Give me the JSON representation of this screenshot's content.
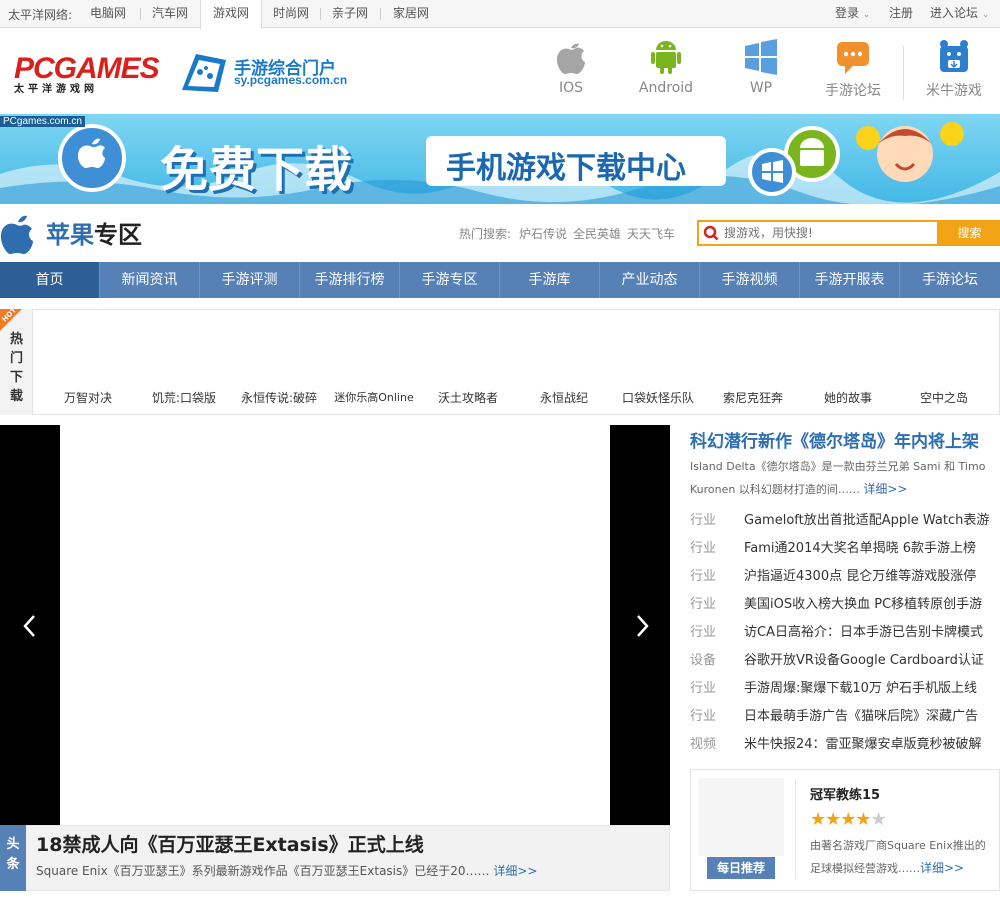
{
  "topbar": {
    "network_label": "太平洋网络:",
    "sites": [
      "电脑网",
      "汽车网",
      "游戏网",
      "时尚网",
      "亲子网",
      "家居网"
    ],
    "login": "登录",
    "register": "注册",
    "forum": "进入论坛"
  },
  "header": {
    "logo_text": "PCGAMES",
    "logo_sub": "太平洋游戏网",
    "portal_title": "手游综合门户",
    "portal_url": "sy.pcgames.com.cn",
    "platforms": [
      "IOS",
      "Android",
      "WP",
      "手游论坛",
      "米牛游戏"
    ]
  },
  "banner": {
    "tag": "PCgames.com.cn",
    "free_download": "免费下载",
    "center_text": "手机游戏下载中心"
  },
  "zone": {
    "title_blue": "苹果",
    "title_dark": "专区",
    "hot_search_label": "热门搜索:",
    "hot_keywords": [
      "炉石传说",
      "全民英雄",
      "天天飞车"
    ],
    "search_placeholder": "搜游戏，用快搜!",
    "search_button": "搜索"
  },
  "nav": [
    "首页",
    "新闻资讯",
    "手游评测",
    "手游排行榜",
    "手游专区",
    "手游库",
    "产业动态",
    "手游视频",
    "手游开服表",
    "手游论坛"
  ],
  "hot_downloads": {
    "badge": "HOT",
    "label_chars": [
      "热",
      "门",
      "下",
      "载"
    ],
    "games": [
      "万智对决",
      "饥荒:口袋版",
      "永恒传说:破碎",
      "迷你乐高Online",
      "沃土攻略者",
      "永恒战纪",
      "口袋妖怪乐队",
      "索尼克狂奔",
      "她的故事",
      "空中之岛"
    ]
  },
  "headline": {
    "tag": "头条",
    "title": "18禁成人向《百万亚瑟王Extasis》正式上线",
    "desc": "Square Enix《百万亚瑟王》系列最新游戏作品《百万亚瑟王Extasis》已经于20……",
    "more": "详细>>"
  },
  "feature": {
    "title": "科幻潜行新作《德尔塔岛》年内将上架",
    "desc": "Island Delta《德尔塔岛》是一款由芬兰兄弟 Sami 和 Timo Kuronen 以科幻题材打造的间……",
    "more": "详细>>"
  },
  "news": [
    {
      "cat": "行业",
      "title": "Gameloft放出首批适配Apple Watch表游"
    },
    {
      "cat": "行业",
      "title": "Fami通2014大奖名单揭晓 6款手游上榜"
    },
    {
      "cat": "行业",
      "title": "沪指逼近4300点 昆仑万维等游戏股涨停"
    },
    {
      "cat": "行业",
      "title": "美国iOS收入榜大换血 PC移植转原创手游"
    },
    {
      "cat": "行业",
      "title": "访CA日高裕介：日本手游已告别卡牌模式"
    },
    {
      "cat": "设备",
      "title": "谷歌开放VR设备Google Cardboard认证"
    },
    {
      "cat": "行业",
      "title": "手游周爆:聚爆下载10万 炉石手机版上线"
    },
    {
      "cat": "行业",
      "title": "日本最萌手游广告《猫咪后院》深藏广告"
    },
    {
      "cat": "视频",
      "title": "米牛快报24：雷亚聚爆安卓版竟秒被破解"
    }
  ],
  "daily": {
    "tag": "每日推荐",
    "title": "冠军教练15",
    "rating": 4,
    "desc": "由著名游戏厂商Square Enix推出的足球模拟经营游戏……",
    "more": "详细>>"
  },
  "colors": {
    "nav": "#5681b6",
    "accent_blue": "#2d6db0",
    "search_orange": "#f2a416",
    "logo_red": "#d9211c"
  }
}
